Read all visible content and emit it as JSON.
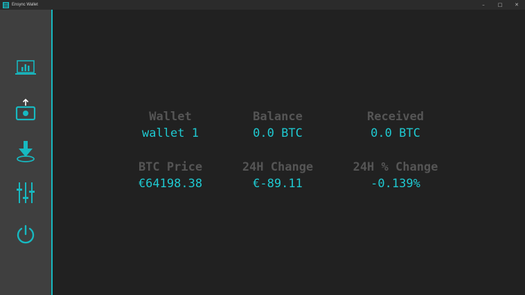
{
  "window": {
    "title": "Ensync Wallet",
    "controls": {
      "minimize": "–",
      "maximize": "□",
      "close": "✕"
    }
  },
  "sidebar": {
    "accent_color": "#17b9c1",
    "items": [
      {
        "name": "dashboard",
        "icon": "chart-icon"
      },
      {
        "name": "send",
        "icon": "send-icon"
      },
      {
        "name": "receive",
        "icon": "download-icon"
      },
      {
        "name": "settings",
        "icon": "sliders-icon"
      },
      {
        "name": "power",
        "icon": "power-icon"
      }
    ]
  },
  "summary": {
    "wallet_label": "Wallet",
    "wallet_value": "wallet 1",
    "balance_label": "Balance",
    "balance_value": "0.0 BTC",
    "received_label": "Received",
    "received_value": "0.0 BTC",
    "price_label": "BTC Price",
    "price_value": "€64198.38",
    "change_label": "24H Change",
    "change_value": "€-89.11",
    "pct_change_label": "24H % Change",
    "pct_change_value": "-0.139%"
  },
  "colors": {
    "label": "#555555",
    "value": "#1fc9d1",
    "background": "#212121",
    "sidebar": "#3f3f3f"
  }
}
